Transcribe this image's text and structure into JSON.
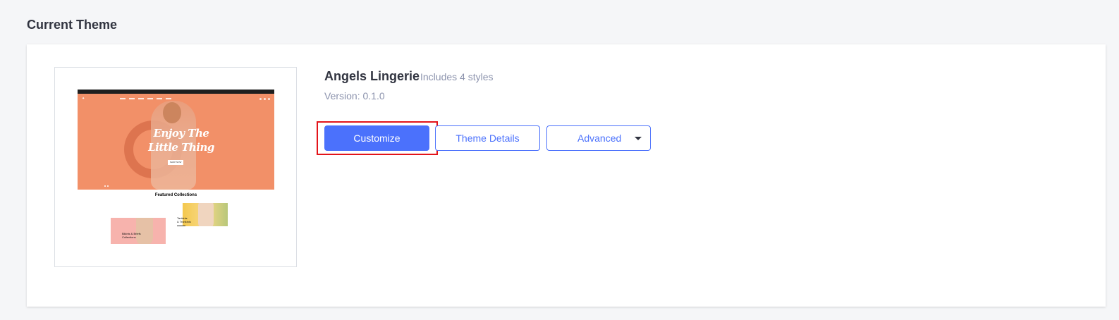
{
  "page": {
    "section_title": "Current Theme"
  },
  "theme": {
    "name": "Angels Lingerie",
    "styles_count": "Includes 4 styles",
    "version": "Version: 0.1.0"
  },
  "preview": {
    "hero_text_line1": "Enjoy The",
    "hero_text_line2": "Little Thing",
    "hero_button": "SHOP NOW",
    "featured_title": "Featured Collections",
    "collection_a_line1": "Bikinis & Briefs",
    "collection_a_line2": "Collections",
    "collection_b_line1": "Tankinis",
    "collection_b_line2": "& Trunkinis"
  },
  "actions": {
    "customize_label": "Customize",
    "details_label": "Theme Details",
    "advanced_label": "Advanced"
  },
  "colors": {
    "accent": "#4b71fc",
    "highlight": "#e3141a",
    "hero_bg": "#f29068",
    "page_bg": "#f5f6f8"
  }
}
